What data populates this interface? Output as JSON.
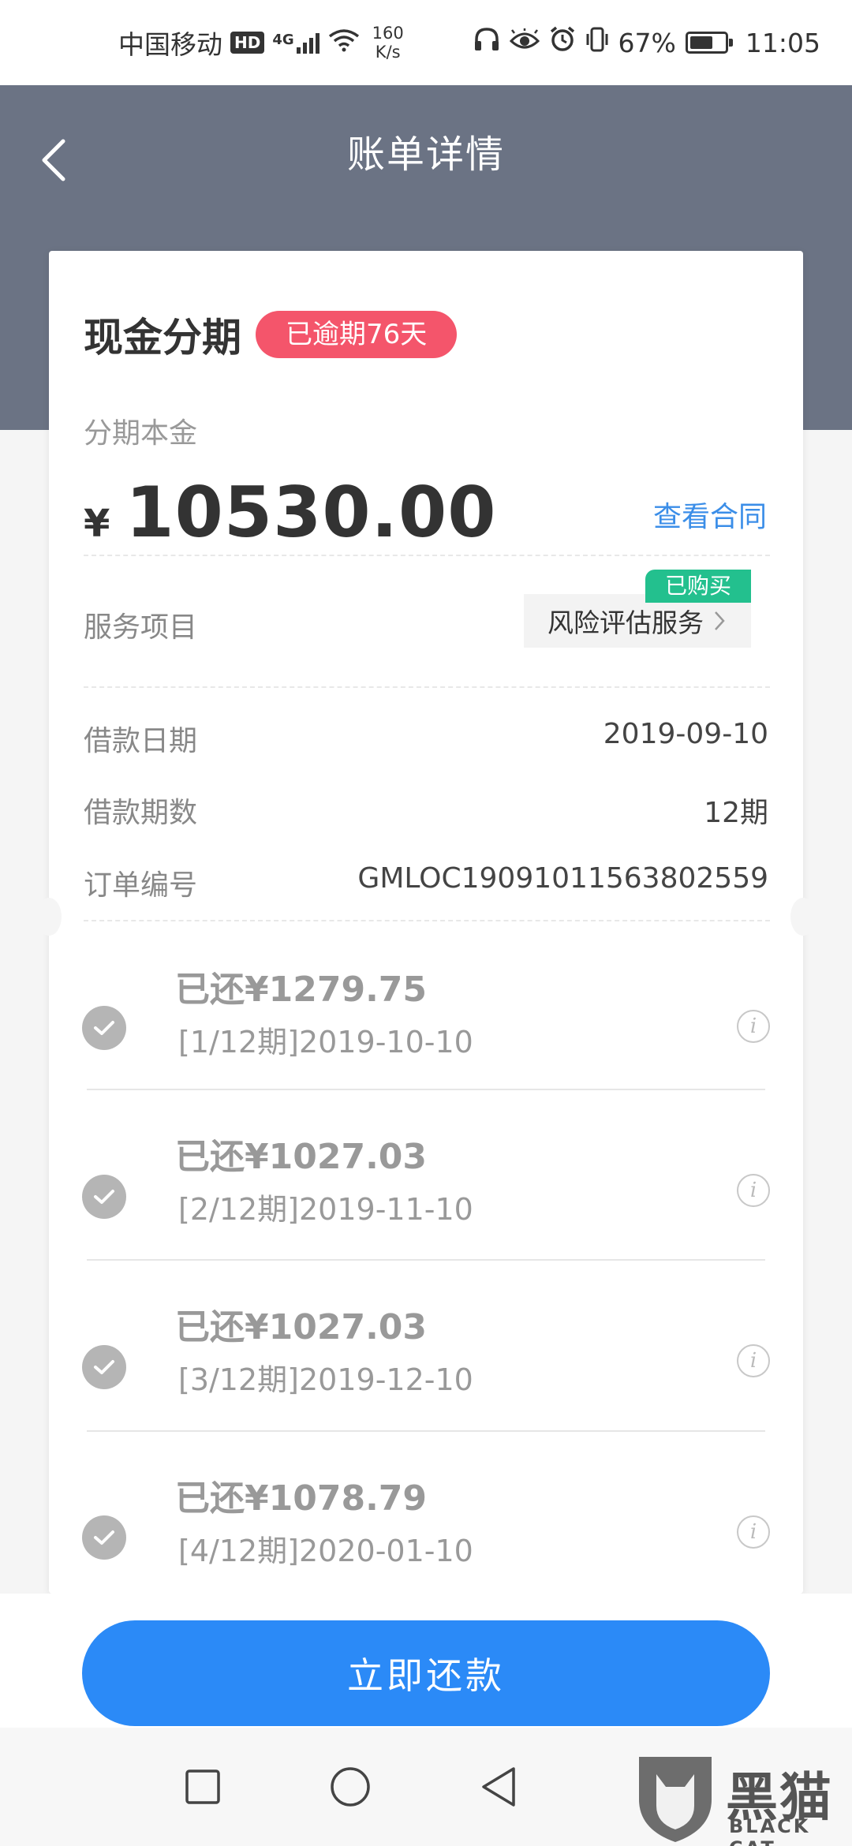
{
  "status_bar": {
    "carrier": "中国移动",
    "hd": "HD",
    "network": "4G",
    "speed_value": "160",
    "speed_unit": "K/s",
    "battery_percent": "67%",
    "battery_level": 0.67,
    "time": "11:05"
  },
  "header": {
    "title": "账单详情"
  },
  "bill": {
    "product_name": "现金分期",
    "overdue_badge": "已逾期76天",
    "principal_label": "分期本金",
    "currency": "¥",
    "amount": "10530.00",
    "contract_link": "查看合同",
    "service_label": "服务项目",
    "service_name": "风险评估服务",
    "service_tag": "已购买",
    "loan_date_label": "借款日期",
    "loan_date": "2019-09-10",
    "loan_periods_label": "借款期数",
    "loan_periods": "12期",
    "order_no_label": "订单编号",
    "order_no": "GMLOC19091011563802559"
  },
  "installments": [
    {
      "amount": "已还¥1279.75",
      "period": "[1/12期]2019-10-10"
    },
    {
      "amount": "已还¥1027.03",
      "period": "[2/12期]2019-11-10"
    },
    {
      "amount": "已还¥1027.03",
      "period": "[3/12期]2019-12-10"
    },
    {
      "amount": "已还¥1078.79",
      "period": "[4/12期]2020-01-10"
    }
  ],
  "actions": {
    "pay_now": "立即还款"
  },
  "watermark": {
    "cn": "黑猫",
    "en": "BLACK CAT"
  },
  "colors": {
    "header_bg": "#6b7384",
    "overdue": "#f4556b",
    "link": "#3b8ee8",
    "tag": "#23c08e",
    "primary_button": "#2b8af7"
  }
}
